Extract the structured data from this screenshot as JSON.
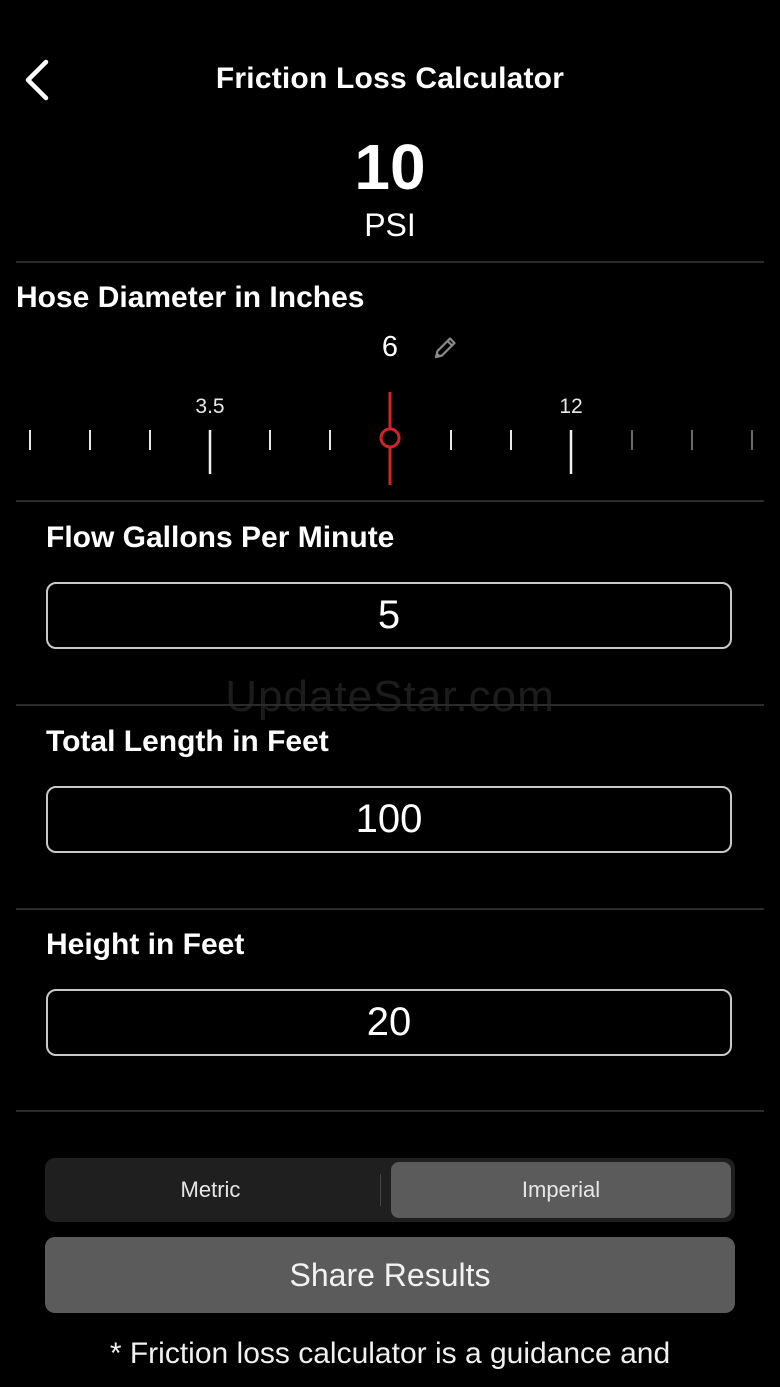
{
  "header": {
    "title": "Friction Loss Calculator",
    "back_icon": "chevron-left-icon"
  },
  "result": {
    "value": "10",
    "unit": "PSI"
  },
  "hose_diameter": {
    "label": "Hose Diameter in Inches",
    "value": "6",
    "edit_icon": "pencil-icon",
    "ruler_labels": [
      "3.5",
      "12"
    ],
    "indicator_color": "#d0242b"
  },
  "flow": {
    "label": "Flow Gallons Per Minute",
    "value": "5"
  },
  "length": {
    "label": "Total Length in Feet",
    "value": "100"
  },
  "height": {
    "label": "Height in Feet",
    "value": "20"
  },
  "units": {
    "options": [
      "Metric",
      "Imperial"
    ],
    "selected": "Imperial"
  },
  "share": {
    "label": "Share Results"
  },
  "footnote": "* Friction loss calculator is a guidance and",
  "watermark": "UpdateStar.com"
}
